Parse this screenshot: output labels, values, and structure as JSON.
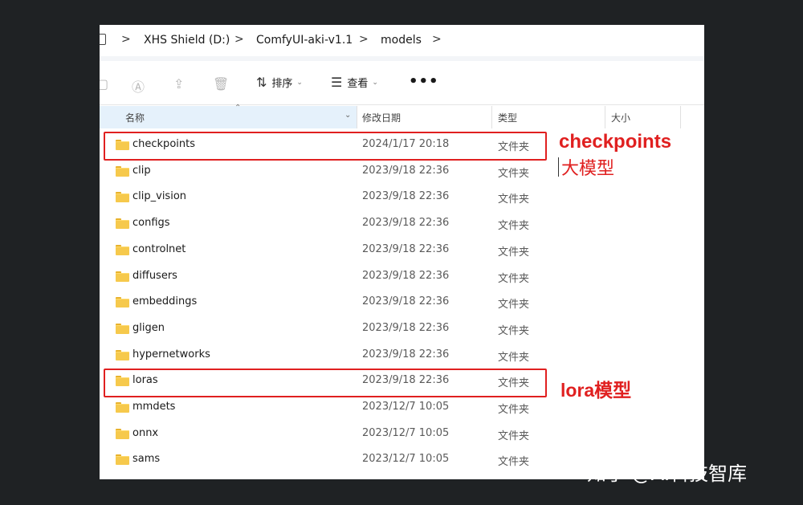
{
  "breadcrumb": {
    "items": [
      "XHS Shield (D:)",
      "ComfyUI-aki-v1.1",
      "models"
    ],
    "separator": ">"
  },
  "toolbar": {
    "sort_label": "排序",
    "view_label": "查看",
    "more_label": "•••",
    "icons": [
      "new-icon",
      "rename-icon",
      "share-icon",
      "delete-icon",
      "sort-icon",
      "view-icon",
      "more-icon"
    ]
  },
  "columns": {
    "name": "名称",
    "date": "修改日期",
    "type": "类型",
    "size": "大小"
  },
  "files": [
    {
      "name": "checkpoints",
      "date": "2024/1/17 20:18",
      "type": "文件夹"
    },
    {
      "name": "clip",
      "date": "2023/9/18 22:36",
      "type": "文件夹"
    },
    {
      "name": "clip_vision",
      "date": "2023/9/18 22:36",
      "type": "文件夹"
    },
    {
      "name": "configs",
      "date": "2023/9/18 22:36",
      "type": "文件夹"
    },
    {
      "name": "controlnet",
      "date": "2023/9/18 22:36",
      "type": "文件夹"
    },
    {
      "name": "diffusers",
      "date": "2023/9/18 22:36",
      "type": "文件夹"
    },
    {
      "name": "embeddings",
      "date": "2023/9/18 22:36",
      "type": "文件夹"
    },
    {
      "name": "gligen",
      "date": "2023/9/18 22:36",
      "type": "文件夹"
    },
    {
      "name": "hypernetworks",
      "date": "2023/9/18 22:36",
      "type": "文件夹"
    },
    {
      "name": "loras",
      "date": "2023/9/18 22:36",
      "type": "文件夹"
    },
    {
      "name": "mmdets",
      "date": "2023/12/7 10:05",
      "type": "文件夹"
    },
    {
      "name": "onnx",
      "date": "2023/12/7 10:05",
      "type": "文件夹"
    },
    {
      "name": "sams",
      "date": "2023/12/7 10:05",
      "type": "文件夹"
    }
  ],
  "annotations": {
    "checkpoints_title": "checkpoints",
    "checkpoints_sub": "大模型",
    "lora_label": "lora模型",
    "color": "#e02020"
  },
  "watermark": "知乎 @AI科技智库"
}
